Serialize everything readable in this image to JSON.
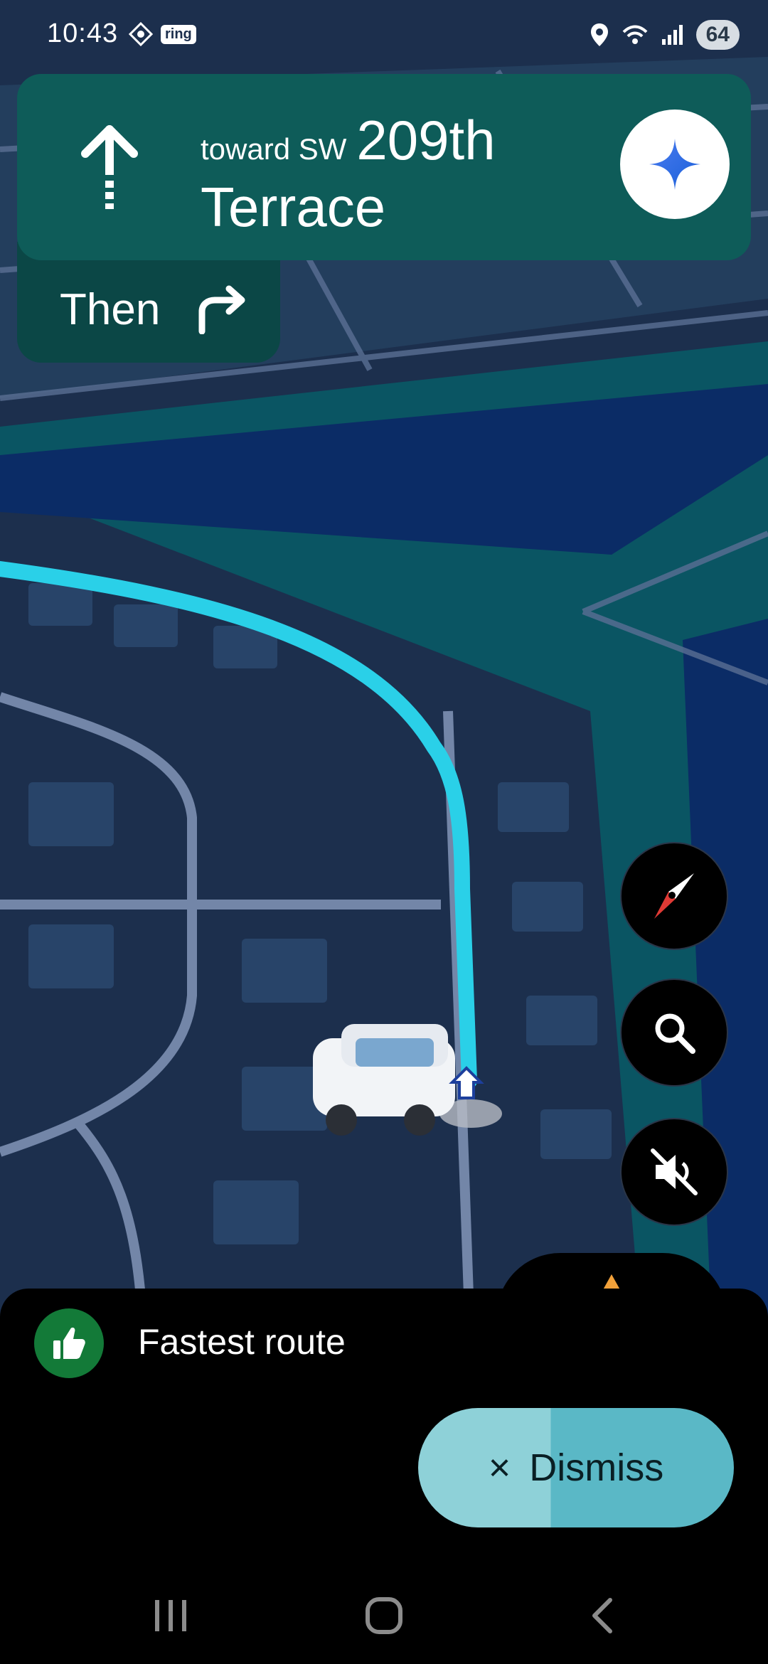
{
  "status_bar": {
    "time": "10:43",
    "app_badge": "ring",
    "battery": "64"
  },
  "direction": {
    "toward": "toward SW",
    "street_number": "209th",
    "street_name": "Terrace",
    "maneuver_icon": "straight-arrow-icon"
  },
  "then": {
    "label": "Then",
    "icon": "turn-right-icon"
  },
  "controls": {
    "compass": "compass-icon",
    "search": "search-icon",
    "mute": "sound-off-icon",
    "assistant": "assistant-sparkle-icon"
  },
  "route_info": {
    "label": "Fastest route",
    "icon": "thumbs-up-icon",
    "badge_color": "#137a38"
  },
  "dismiss": {
    "icon_text": "×",
    "label": "Dismiss"
  },
  "colors": {
    "card": "#0e5c59",
    "route": "#2ad0e8",
    "map_base": "#1c2f4d"
  }
}
